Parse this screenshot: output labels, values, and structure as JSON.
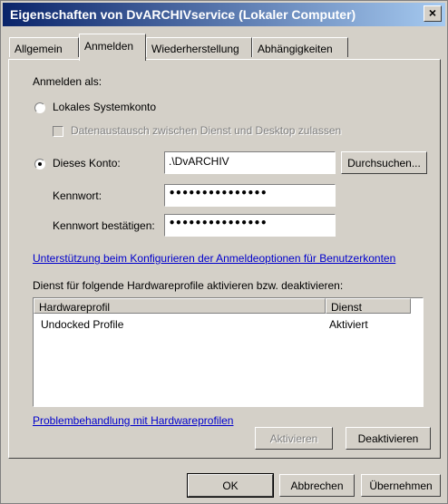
{
  "window": {
    "title": "Eigenschaften von DvARCHIVservice (Lokaler Computer)",
    "close_glyph": "×"
  },
  "tabs": [
    {
      "label": "Allgemein"
    },
    {
      "label": "Anmelden"
    },
    {
      "label": "Wiederherstellung"
    },
    {
      "label": "Abhängigkeiten"
    }
  ],
  "active_tab": "Anmelden",
  "logon": {
    "heading": "Anmelden als:",
    "local_system_label": "Lokales Systemkonto",
    "desktop_interaction_label": "Datenaustausch zwischen Dienst und Desktop zulassen",
    "this_account_label": "Dieses Konto:",
    "account_value": ".\\DvARCHIV",
    "browse_label": "Durchsuchen...",
    "password_label": "Kennwort:",
    "password_mask": "•••••••••••••••",
    "confirm_label": "Kennwort bestätigen:",
    "confirm_mask": "•••••••••••••••"
  },
  "help_link": "Unterstützung beim Konfigurieren der Anmeldeoptionen für Benutzerkonten",
  "profiles": {
    "heading": "Dienst für folgende Hardwareprofile aktivieren bzw. deaktivieren:",
    "columns": [
      "Hardwareprofil",
      "Dienst"
    ],
    "rows": [
      {
        "profile": "Undocked Profile",
        "service": "Aktiviert"
      }
    ]
  },
  "troubleshoot_link": "Problembehandlung mit Hardwareprofilen",
  "buttons": {
    "activate": "Aktivieren",
    "deactivate": "Deaktivieren",
    "ok": "OK",
    "cancel": "Abbrechen",
    "apply": "Übernehmen"
  }
}
